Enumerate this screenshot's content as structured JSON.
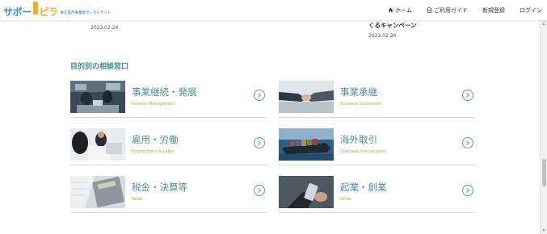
{
  "header": {
    "logo_text_main": "サポー",
    "logo_text_accent": "ピラ",
    "logo_subtitle": "東広島市事業者ポータルサイト",
    "nav": [
      {
        "label": "ホーム",
        "icon": "home-icon"
      },
      {
        "label": "ご利用ガイド",
        "icon": "document-icon"
      },
      {
        "label": "新規登録",
        "icon": ""
      },
      {
        "label": "ログイン",
        "icon": ""
      }
    ]
  },
  "news": {
    "left_date": "2023.02.24",
    "right_title": "くるキャンペーン",
    "right_date": "2023.02.24"
  },
  "section": {
    "heading": "目的別の相談窓口"
  },
  "consult_cards": [
    {
      "title": "事業継続・発展",
      "subtitle": "General Management",
      "image": "office-meeting-photo"
    },
    {
      "title": "事業承継",
      "subtitle": "Business Succession",
      "image": "handshake-photo"
    },
    {
      "title": "雇用・労働",
      "subtitle": "Employment & Labor",
      "image": "team-discussion-photo"
    },
    {
      "title": "海外取引",
      "subtitle": "Overseas transactions",
      "image": "container-ship-photo"
    },
    {
      "title": "税金・決算等",
      "subtitle": "Taxes",
      "image": "calculator-photo"
    },
    {
      "title": "起業・創業",
      "subtitle": "Other",
      "image": "smartphone-photo"
    }
  ],
  "colors": {
    "accent_teal": "#4f8f93",
    "subtitle_gold": "#b2a44c",
    "logo_blue": "#2f8ec3",
    "logo_yellow": "#f2b01e"
  }
}
